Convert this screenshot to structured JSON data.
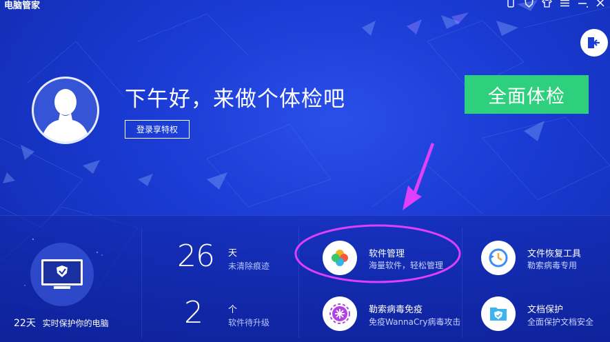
{
  "app": {
    "title": "电脑管家"
  },
  "hero": {
    "greeting": "下午好，来做个体检吧",
    "login_label": "登录享特权",
    "scan_label": "全面体检"
  },
  "protection": {
    "days": "22天",
    "text": "实时保护你的电脑"
  },
  "stats": [
    {
      "value": "26",
      "unit": "天",
      "desc": "未清除痕迹"
    },
    {
      "value": "2",
      "unit": "个",
      "desc": "软件待升级"
    }
  ],
  "tools": [
    {
      "title": "软件管理",
      "desc": "海量软件，轻松管理",
      "icon": "software-clover-icon"
    },
    {
      "title": "文件恢复工具",
      "desc": "勒索病毒专用",
      "icon": "file-restore-icon"
    },
    {
      "title": "勒索病毒免疫",
      "desc": "免疫WannaCry病毒攻击",
      "icon": "virus-immune-icon"
    },
    {
      "title": "文档保护",
      "desc": "全面保护文档安全",
      "icon": "document-shield-icon"
    }
  ],
  "colors": {
    "background": "#1a3bd4",
    "scan_button": "#2ed07d",
    "highlight": "#e040fb"
  }
}
